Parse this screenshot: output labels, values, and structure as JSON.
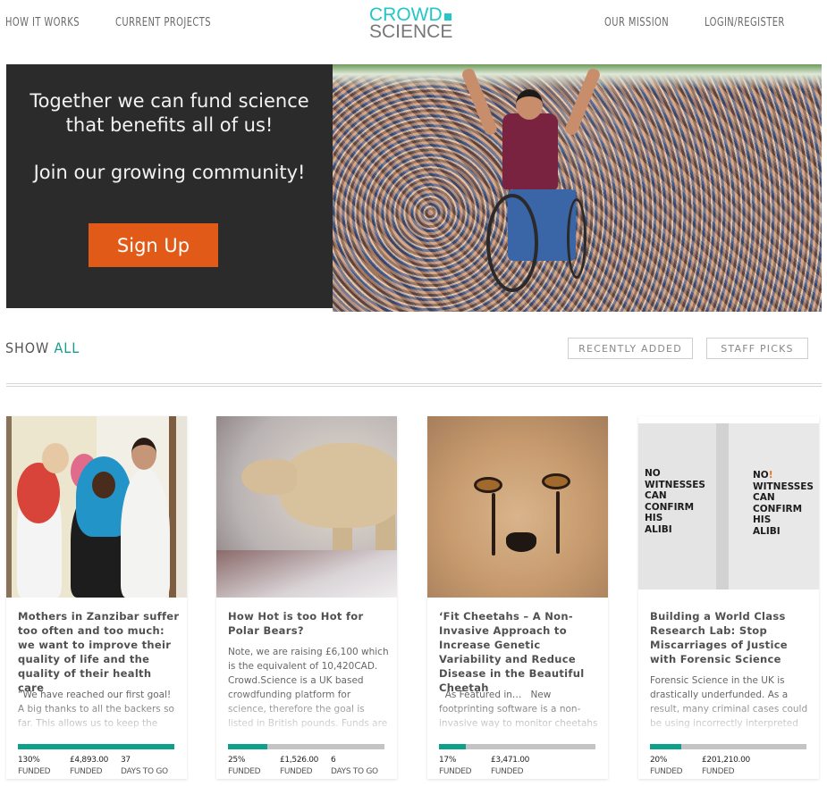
{
  "header": {
    "nav_left": [
      "HOW IT WORKS",
      "CURRENT PROJECTS"
    ],
    "nav_right": [
      "OUR MISSION",
      "LOGIN/REGISTER"
    ],
    "logo": {
      "line1": "CROWD",
      "line2": "SCIENCE"
    }
  },
  "hero": {
    "line1": "Together we can fund science",
    "line2": "that benefits all of us!",
    "line3": "Join our growing community!",
    "signup_label": "Sign Up",
    "image_alt": "Crowd lifting a man in a wheelchair at a festival"
  },
  "filter": {
    "show_label": "SHOW",
    "show_value": "ALL",
    "buttons": [
      "RECENTLY ADDED",
      "STAFF PICKS"
    ]
  },
  "colors": {
    "accent": "#0da08a",
    "logo_teal": "#22c7c7",
    "signup_orange": "#e25a17",
    "hero_bg": "#2b2b2b"
  },
  "projects": [
    {
      "title": "Mothers in Zanzibar suffer too often and too much: we want to improve their quality of life and the quality of their health care",
      "description": "“We have reached our first goal! A big thanks to all the backers so far. This allows us to keep the research",
      "image": "zanzibar-health-workers",
      "progress_percent": 130,
      "stats": [
        {
          "value": "130%",
          "label": "FUNDED"
        },
        {
          "value": "£4,893.00",
          "label": "FUNDED"
        },
        {
          "value": "37",
          "label": "DAYS TO GO"
        }
      ]
    },
    {
      "title": "How Hot is too Hot for Polar Bears?",
      "description": "Note, we are raising £6,100 which is the equivalent of 10,420CAD. Crowd.Science is a UK based crowdfunding platform for science, therefore the goal is listed in British pounds. Funds are collected using",
      "image": "polar-bear",
      "progress_percent": 25,
      "stats": [
        {
          "value": "25%",
          "label": "FUNDED"
        },
        {
          "value": "£1,526.00",
          "label": "FUNDED"
        },
        {
          "value": "6",
          "label": "DAYS TO GO"
        }
      ]
    },
    {
      "title": "‘Fit Cheetahs – A Non-Invasive Approach to Increase Genetic Variability and Reduce Disease in the Beautiful Cheetah",
      "description": "  As Featured in…   New footprinting software is a non-invasive way to monitor cheetahs in the wild and",
      "image": "cheetah-cub",
      "progress_percent": 17,
      "stats": [
        {
          "value": "17%",
          "label": "FUNDED"
        },
        {
          "value": "£3,471.00",
          "label": "FUNDED"
        }
      ]
    },
    {
      "title": "Building a World Class Research Lab: Stop Miscarriages of Justice with Forensic Science",
      "description": "Forensic Science in the UK is drastically underfunded. As a result, many criminal cases could be using incorrectly interpreted evidence to",
      "image": "no-witnesses-poster",
      "image_text_left": [
        "NO",
        "WITNESSES",
        "CAN",
        "CONFIRM",
        "HIS",
        "ALIBI"
      ],
      "image_text_right": [
        "NO",
        "!",
        "WITNESSES",
        "CAN",
        "CONFIRM",
        "HIS",
        "ALIBI"
      ],
      "progress_percent": 20,
      "stats": [
        {
          "value": "20%",
          "label": "FUNDED"
        },
        {
          "value": "£201,210.00",
          "label": "FUNDED"
        }
      ]
    }
  ]
}
